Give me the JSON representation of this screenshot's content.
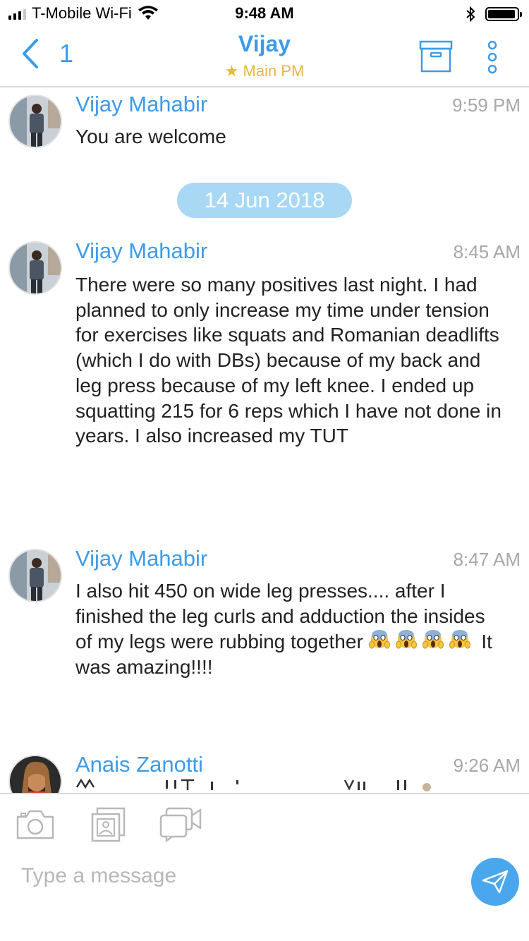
{
  "status_bar": {
    "carrier": "T-Mobile Wi-Fi",
    "time": "9:48 AM"
  },
  "nav": {
    "back_count": "1",
    "title": "Vijay",
    "subtitle": "★ Main PM"
  },
  "messages": [
    {
      "sender": "Vijay Mahabir",
      "time": "9:59 PM",
      "text": "You are welcome"
    },
    {
      "sender": "Vijay Mahabir",
      "time": "8:45 AM",
      "text": "There were so many positives last night. I had planned to only increase my time under tension for exercises like squats and Romanian deadlifts (which I do with DBs) because of my back and leg press because of my left knee. I ended up squatting 215 for 6 reps which I have not done in years. I also increased my TUT"
    },
    {
      "sender": "Vijay Mahabir",
      "time": "8:47 AM",
      "text_before_emoji": "I also hit 450 on wide leg presses.... after I finished the leg curls and adduction the insides of my legs were rubbing together",
      "text_after_emoji": " It was amazing!!!!"
    },
    {
      "sender": "Anais Zanotti",
      "time": "9:26 AM"
    }
  ],
  "date_divider": "14 Jun 2018",
  "composer": {
    "placeholder": "Type a message"
  },
  "colors": {
    "accent": "#3d9be9",
    "star": "#e8b640",
    "date_pill": "#a8d8f4",
    "send": "#4aa7ee"
  }
}
